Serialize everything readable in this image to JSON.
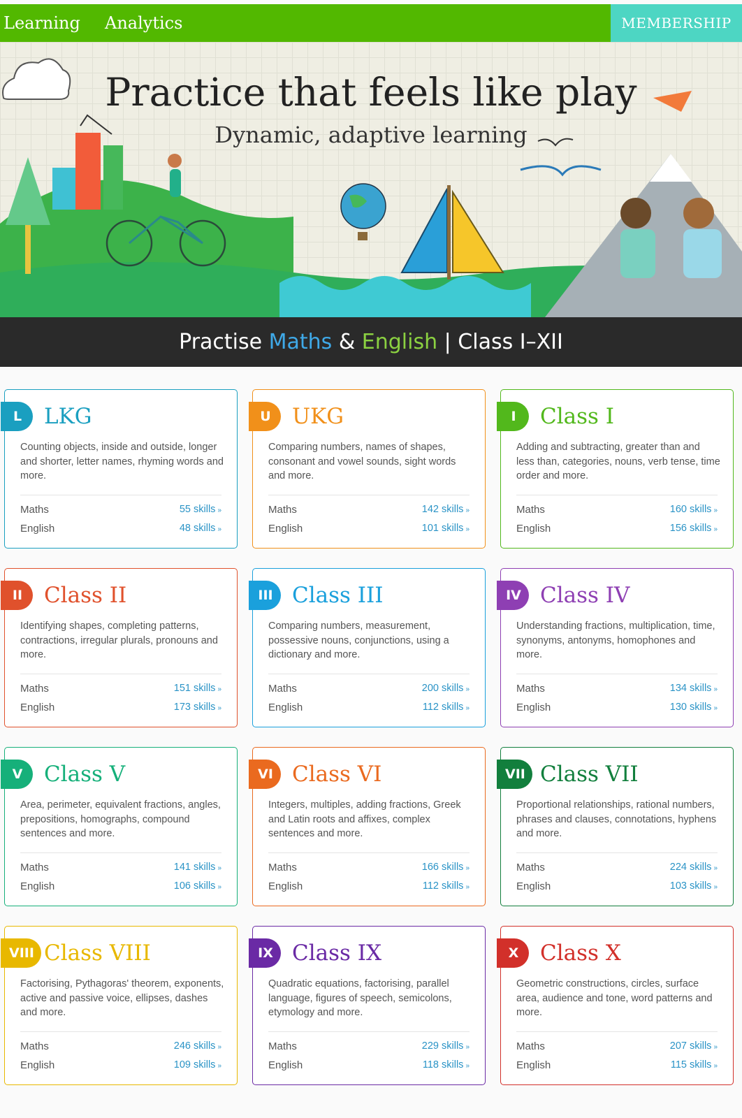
{
  "nav": {
    "learning": "Learning",
    "analytics": "Analytics",
    "membership": "MEMBERSHIP"
  },
  "hero": {
    "title": "Practice that feels like play",
    "subtitle": "Dynamic, adaptive learning"
  },
  "band": {
    "prefix": "Practise ",
    "maths": "Maths",
    "amp": " & ",
    "english": "English",
    "suffix": " | Class I–XII"
  },
  "labels": {
    "maths": "Maths",
    "english": "English",
    "arrow": "»"
  },
  "colors": {
    "nav_green": "#52b800",
    "membership_teal": "#4dd6c3",
    "link_blue": "#2a93c6"
  },
  "cards": [
    {
      "badge": "L",
      "title": "LKG",
      "color": "#1a9fc0",
      "desc": "Counting objects, inside and outside, longer and shorter, letter names, rhyming words and more.",
      "maths_skills": "55 skills",
      "english_skills": "48 skills"
    },
    {
      "badge": "U",
      "title": "UKG",
      "color": "#f1901a",
      "desc": "Comparing numbers, names of shapes, consonant and vowel sounds, sight words and more.",
      "maths_skills": "142 skills",
      "english_skills": "101 skills"
    },
    {
      "badge": "I",
      "title": "Class I",
      "color": "#52b81c",
      "desc": "Adding and subtracting, greater than and less than, categories, nouns, verb tense, time order and more.",
      "maths_skills": "160 skills",
      "english_skills": "156 skills"
    },
    {
      "badge": "II",
      "title": "Class II",
      "color": "#e0512c",
      "desc": "Identifying shapes, completing patterns, contractions, irregular plurals, pronouns and more.",
      "maths_skills": "151 skills",
      "english_skills": "173 skills"
    },
    {
      "badge": "III",
      "title": "Class III",
      "color": "#1aa0dc",
      "desc": "Comparing numbers, measurement, possessive nouns, conjunctions, using a dictionary and more.",
      "maths_skills": "200 skills",
      "english_skills": "112 skills"
    },
    {
      "badge": "IV",
      "title": "Class IV",
      "color": "#8e3fb3",
      "desc": "Understanding fractions, multiplication, time, synonyms, antonyms, homophones and more.",
      "maths_skills": "134 skills",
      "english_skills": "130 skills"
    },
    {
      "badge": "V",
      "title": "Class V",
      "color": "#16b07a",
      "desc": "Area, perimeter, equivalent fractions, angles, prepositions, homographs, compound sentences and more.",
      "maths_skills": "141 skills",
      "english_skills": "106 skills"
    },
    {
      "badge": "VI",
      "title": "Class VI",
      "color": "#ea6a1f",
      "desc": "Integers, multiples, adding fractions, Greek and Latin roots and affixes, complex sentences and more.",
      "maths_skills": "166 skills",
      "english_skills": "112 skills"
    },
    {
      "badge": "VII",
      "title": "Class VII",
      "color": "#127f3d",
      "desc": "Proportional relationships, rational numbers, phrases and clauses, connotations, hyphens and more.",
      "maths_skills": "224 skills",
      "english_skills": "103 skills"
    },
    {
      "badge": "VIII",
      "title": "Class VIII",
      "color": "#e8b800",
      "desc": "Factorising, Pythagoras' theorem, exponents, active and passive voice, ellipses, dashes and more.",
      "maths_skills": "246 skills",
      "english_skills": "109 skills"
    },
    {
      "badge": "IX",
      "title": "Class IX",
      "color": "#6a2aa5",
      "desc": "Quadratic equations, factorising, parallel language, figures of speech, semicolons, etymology and more.",
      "maths_skills": "229 skills",
      "english_skills": "118 skills"
    },
    {
      "badge": "X",
      "title": "Class X",
      "color": "#d2302a",
      "desc": "Geometric constructions, circles, surface area, audience and tone, word patterns and more.",
      "maths_skills": "207 skills",
      "english_skills": "115 skills"
    }
  ]
}
